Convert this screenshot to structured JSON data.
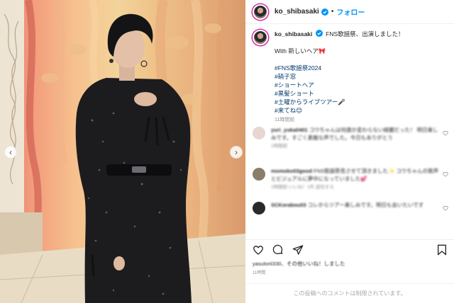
{
  "header": {
    "username": "ko_shibasaki",
    "separator": "•",
    "follow_label": "フォロー",
    "verified_color": "#0095f6"
  },
  "caption": {
    "username": "ko_shibasaki",
    "text_line1": "FNS歌謡祭、出演しました！",
    "text_line2": "With 新しいヘア🎀",
    "hashtags": [
      "#FNS歌謡祭2024",
      "#硝子窓",
      "#ショートヘア",
      "#黒髪ショート",
      "#土曜からライブツアー🎤",
      "#来てね😊"
    ],
    "timestamp": "11時間前"
  },
  "comments": [
    {
      "username": "yuri_yuka0401",
      "text": "コウちゃんは何歳か変わらない綺麗だった！ 明日楽しみです。すごく素敵な声でした。今日もありがとう",
      "meta": "1時間前"
    },
    {
      "username": "momoko03good",
      "text": "FNS歌謡祭見させて頂きました✨ コウちゃんの歌声とビジュアルに夢中になっていました💕",
      "meta": "1時間前  いいね！1件  返信する"
    },
    {
      "username": "SCKorabou03",
      "text": "コレからツアー楽しみです。明日も会いたいです",
      "meta": ""
    }
  ],
  "likes": {
    "text": "yasutorii330、その他いいね！しました",
    "date": "11時間"
  },
  "footer": {
    "comments_disabled": "この投稿へのコメントは制限されています。"
  },
  "colors": {
    "accent": "#0095f6",
    "hashtag": "#00376b",
    "muted": "#8e8e8e"
  },
  "icons": {
    "prev": "chevron-left-icon",
    "next": "chevron-right-icon",
    "like": "heart-icon",
    "comment": "comment-icon",
    "share": "share-icon",
    "save": "bookmark-icon"
  }
}
